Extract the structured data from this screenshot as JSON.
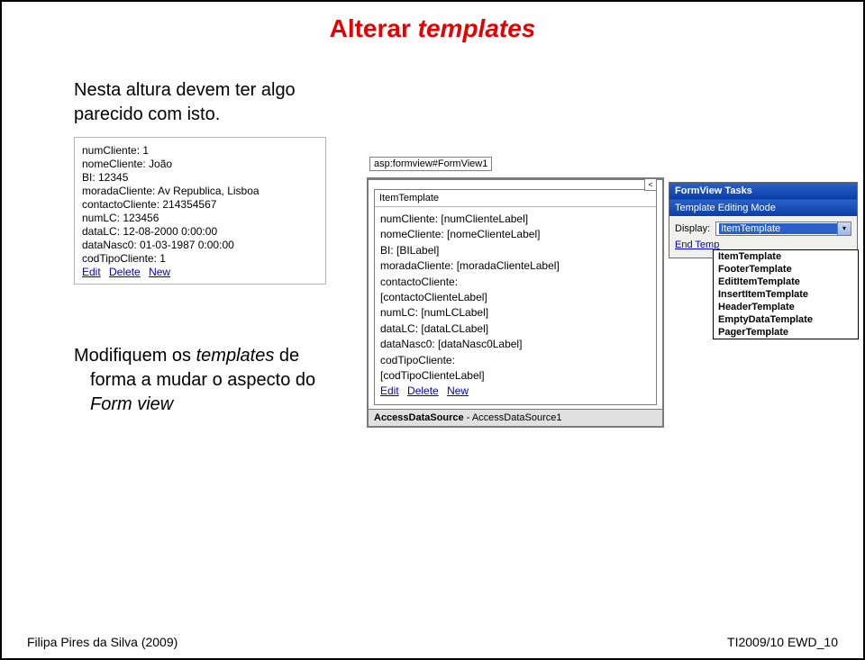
{
  "title": {
    "t1": "Alterar ",
    "t2": "templates"
  },
  "para1": {
    "l1": "Nesta altura devem ter algo",
    "l2": "parecido com isto."
  },
  "para2": {
    "l1": "Modifiquem os ",
    "l1i": "templates",
    "l1b": " de",
    "l2": "forma a mudar o aspecto do",
    "l3": "Form view"
  },
  "leftShot": {
    "rows": [
      "numCliente: 1",
      "nomeCliente: João",
      "BI: 12345",
      "moradaCliente: Av Republica, Lisboa",
      "contactoCliente: 214354567",
      "numLC: 123456",
      "dataLC: 12-08-2000 0:00:00",
      "dataNasc0: 01-03-1987 0:00:00",
      "codTipoCliente: 1"
    ],
    "links": [
      "Edit",
      "Delete",
      "New"
    ]
  },
  "rightShot": {
    "tag": "asp:formview#FormView1",
    "arrow": "<",
    "headerLabel": "ItemTemplate",
    "bodyLines": [
      "numCliente: [numClienteLabel]",
      "nomeCliente: [nomeClienteLabel]",
      "BI: [BILabel]",
      "moradaCliente: [moradaClienteLabel]",
      "contactoCliente:",
      "[contactoClienteLabel]",
      "numLC: [numLCLabel]",
      "dataLC: [dataLCLabel]",
      "dataNasc0: [dataNasc0Label]",
      "codTipoCliente:",
      "[codTipoClienteLabel]"
    ],
    "bodyLinks": [
      "Edit",
      "Delete",
      "New"
    ],
    "dataSourceLabel": "AccessDataSource",
    "dataSourceValue": " - AccessDataSource1"
  },
  "tasks": {
    "title": "FormView Tasks",
    "subtitle": "Template Editing Mode",
    "displayLabel": "Display:",
    "selected": "ItemTemplate",
    "endLabel": "End Temp",
    "options": [
      "ItemTemplate",
      "FooterTemplate",
      "EditItemTemplate",
      "InsertItemTemplate",
      "HeaderTemplate",
      "EmptyDataTemplate",
      "PagerTemplate"
    ]
  },
  "footer": {
    "left": "Filipa Pires da Silva (2009)",
    "right": "TI2009/10 EWD_10"
  }
}
